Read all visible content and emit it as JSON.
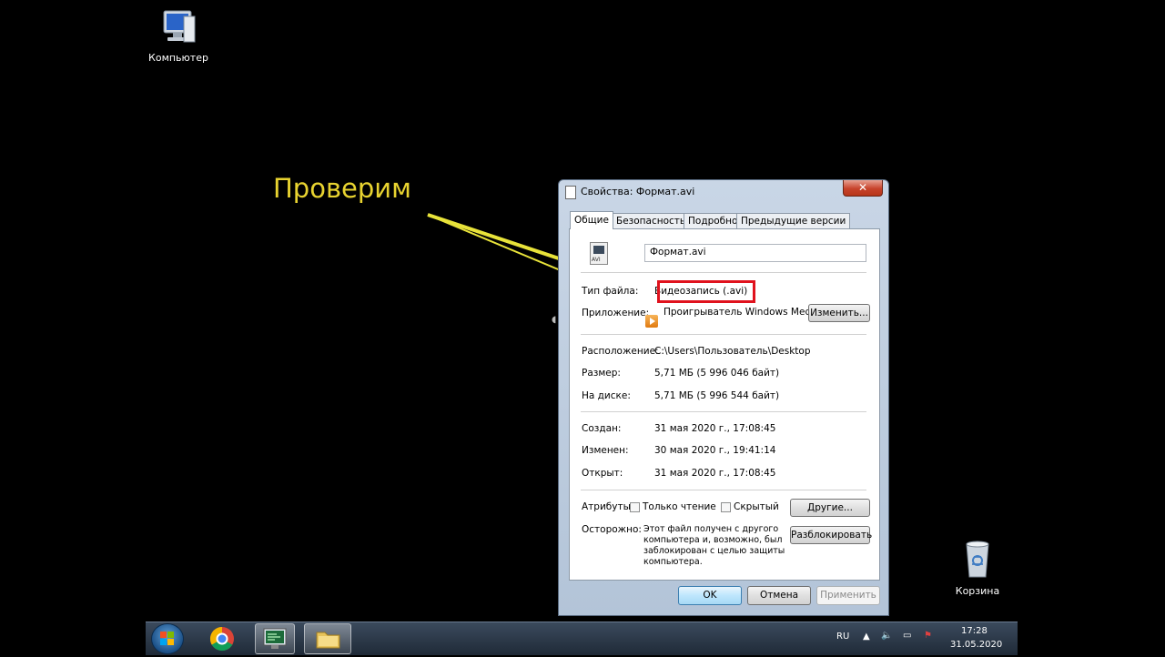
{
  "desktop": {
    "icons": [
      {
        "label": "Компьютер",
        "icon": "computer-icon"
      },
      {
        "label": "Корзина",
        "icon": "recycle-bin-icon"
      }
    ]
  },
  "annotation": {
    "text": "Проверим",
    "color": "#e8d330",
    "highlight_color": "#e0121d"
  },
  "dialog": {
    "title": "Свойства: Формат.avi",
    "close_label": "✕",
    "tabs": [
      "Общие",
      "Безопасность",
      "Подробно",
      "Предыдущие версии"
    ],
    "active_tab": "Общие",
    "file_name": "Формат.avi",
    "file_icon_ext": "AVI",
    "fields": {
      "type_label": "Тип файла:",
      "type_value": "Видеозапись (.avi)",
      "app_label": "Приложение:",
      "app_value": "Проигрыватель Windows Media",
      "change_button": "Изменить...",
      "location_label": "Расположение:",
      "location_value": "C:\\Users\\Пользователь\\Desktop",
      "size_label": "Размер:",
      "size_value": "5,71 МБ (5 996 046 байт)",
      "disk_label": "На диске:",
      "disk_value": "5,71 МБ (5 996 544 байт)",
      "created_label": "Создан:",
      "created_value": "31 мая 2020 г., 17:08:45",
      "modified_label": "Изменен:",
      "modified_value": "30 мая 2020 г., 19:41:14",
      "opened_label": "Открыт:",
      "opened_value": "31 мая 2020 г., 17:08:45",
      "attributes_label": "Атрибуты:",
      "readonly_label": "Только чтение",
      "hidden_label": "Скрытый",
      "other_button": "Другие...",
      "warning_label": "Осторожно:",
      "warning_lines": [
        "Этот файл получен с другого",
        "компьютера и, возможно, был",
        "заблокирован с целью защиты",
        "компьютера."
      ],
      "unblock_button": "Разблокировать"
    },
    "buttons": {
      "ok": "OK",
      "cancel": "Отмена",
      "apply": "Применить"
    }
  },
  "taskbar": {
    "pinned": [
      {
        "icon": "start-orb-icon"
      },
      {
        "icon": "chrome-icon"
      },
      {
        "icon": "computer-monitor-icon"
      },
      {
        "icon": "folder-explorer-icon"
      }
    ],
    "language": "RU",
    "time": "17:28",
    "date": "31.05.2020"
  }
}
